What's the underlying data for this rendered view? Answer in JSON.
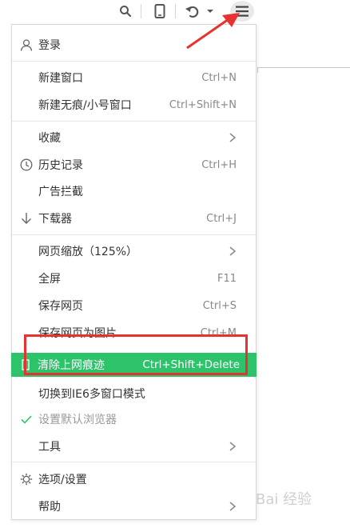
{
  "menu": {
    "login": "登录",
    "new_window": {
      "label": "新建窗口",
      "shortcut": "Ctrl+N"
    },
    "new_private": {
      "label": "新建无痕/小号窗口",
      "shortcut": "Ctrl+Shift+N"
    },
    "favorites": {
      "label": "收藏"
    },
    "history": {
      "label": "历史记录",
      "shortcut": "Ctrl+H"
    },
    "adblock": {
      "label": "广告拦截"
    },
    "downloads": {
      "label": "下载器",
      "shortcut": "Ctrl+J"
    },
    "zoom": {
      "label": "网页缩放（125%）"
    },
    "fullscreen": {
      "label": "全屏",
      "shortcut": "F11"
    },
    "save_page": {
      "label": "保存网页",
      "shortcut": "Ctrl+S"
    },
    "save_as_image": {
      "label": "保存网页为图片",
      "shortcut": "Ctrl+M"
    },
    "clear_traces": {
      "label": "清除上网痕迹",
      "shortcut": "Ctrl+Shift+Delete"
    },
    "ie6_mode": {
      "label": "切换到IE6多窗口模式"
    },
    "default_browser": {
      "label": "设置默认浏览器"
    },
    "tools": {
      "label": "工具"
    },
    "options": {
      "label": "选项/设置"
    },
    "help": {
      "label": "帮助"
    }
  },
  "watermark": "Bai 经验",
  "colors": {
    "active": "#2cc36b",
    "annotation": "#e8322f"
  },
  "icons": [
    "search-icon",
    "phone-icon",
    "undo-icon",
    "chevron-down-icon",
    "hamburger-menu-icon",
    "user-icon",
    "clock-icon",
    "download-arrow-icon",
    "checkmark-icon",
    "gear-icon",
    "chevron-right-icon"
  ]
}
